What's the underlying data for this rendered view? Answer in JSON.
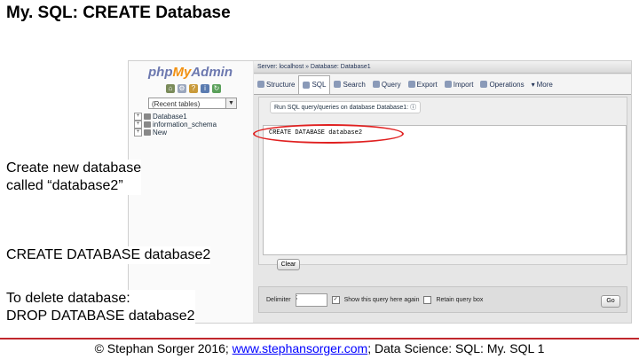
{
  "slide": {
    "title": "My. SQL: CREATE Database",
    "note1_line1": "Create new database",
    "note1_line2": "called “database2”",
    "note2": "CREATE DATABASE database2",
    "note3_line1": "To delete database:",
    "note3_line2": "DROP DATABASE database2",
    "highlight_color": "#e02020",
    "rule_color": "#c0272d"
  },
  "footer": {
    "prefix": "© Stephan Sorger 2016; ",
    "link": "www.stephansorger.com",
    "suffix": "; Data Science: SQL: My. SQL 1"
  },
  "pma": {
    "logo_php": "php",
    "logo_my": "My",
    "logo_admin": "Admin",
    "recent_tables": "(Recent tables)",
    "tree": [
      "Database1",
      "information_schema",
      "New"
    ],
    "breadcrumb": "Server: localhost » Database: Database1",
    "tabs": [
      {
        "label": "Structure",
        "icon": "structure-icon"
      },
      {
        "label": "SQL",
        "icon": "sql-icon"
      },
      {
        "label": "Search",
        "icon": "search-icon"
      },
      {
        "label": "Query",
        "icon": "query-icon"
      },
      {
        "label": "Export",
        "icon": "export-icon"
      },
      {
        "label": "Import",
        "icon": "import-icon"
      },
      {
        "label": "Operations",
        "icon": "operations-icon"
      },
      {
        "label": "More",
        "icon": "chevron-down-icon"
      }
    ],
    "active_tab": "SQL",
    "run_label": "Run SQL query/queries on database Database1:",
    "query_text": "CREATE DATABASE database2",
    "clear_label": "Clear",
    "delimiter_label": "Delimiter",
    "delimiter_value": ";",
    "show_query_label": "Show this query here again",
    "retain_box_label": "Retain query box",
    "go_label": "Go"
  }
}
